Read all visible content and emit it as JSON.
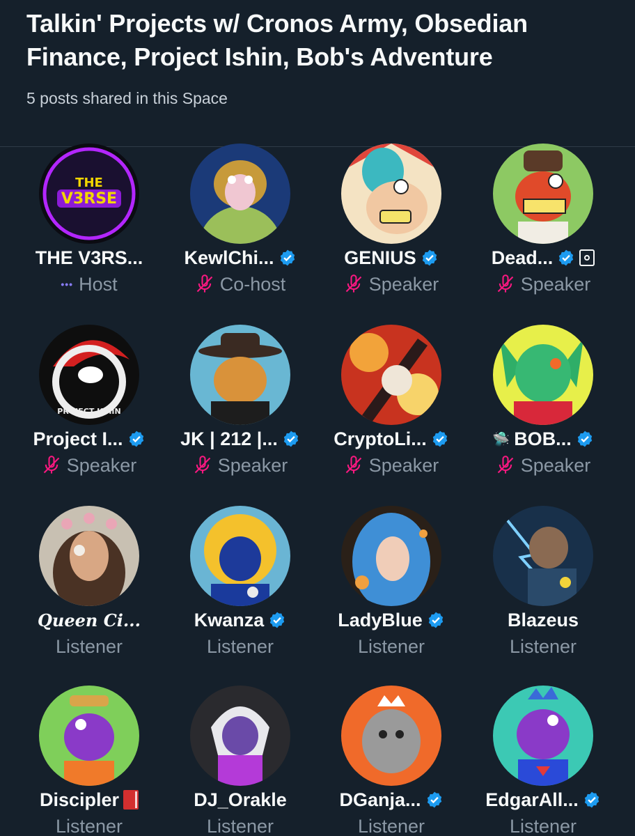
{
  "space": {
    "title": "Talkin' Projects w/ Cronos Army, Obsedian Finance, Project Ishin, Bob's Adventure",
    "posts_shared": "5 posts shared in this Space"
  },
  "colors": {
    "background": "#15202b",
    "verified": "#1d9bf0",
    "muted_mic": "#f91880",
    "host_dots": "#8a7dff",
    "role_text": "#8b98a5"
  },
  "participants": [
    {
      "name": "THE V3RS...",
      "role": "Host",
      "verified": false
    },
    {
      "name": "KewlChi...",
      "role": "Co-host",
      "verified": true
    },
    {
      "name": "GENIUS",
      "role": "Speaker",
      "verified": true
    },
    {
      "name": "Dead...",
      "role": "Speaker",
      "verified": true
    },
    {
      "name": "Project I...",
      "role": "Speaker",
      "verified": true
    },
    {
      "name": "JK | 212 |...",
      "role": "Speaker",
      "verified": true
    },
    {
      "name": "CryptoLi...",
      "role": "Speaker",
      "verified": true
    },
    {
      "name": "BOB...",
      "role": "Speaker",
      "verified": true
    },
    {
      "name": "Queen Ci...",
      "role": "Listener",
      "verified": false
    },
    {
      "name": "Kwanza",
      "role": "Listener",
      "verified": true
    },
    {
      "name": "LadyBlue",
      "role": "Listener",
      "verified": true
    },
    {
      "name": "Blazeus",
      "role": "Listener",
      "verified": false
    },
    {
      "name": "Discipler",
      "role": "Listener",
      "verified": false
    },
    {
      "name": "DJ_Orakle",
      "role": "Listener",
      "verified": false
    },
    {
      "name": "DGanja...",
      "role": "Listener",
      "verified": true
    },
    {
      "name": "EdgarAll...",
      "role": "Listener",
      "verified": true
    }
  ],
  "avatar_logos": {
    "the_v3rse": "THE V3RSE",
    "project_ishin": "PROJECT ISHIN"
  }
}
